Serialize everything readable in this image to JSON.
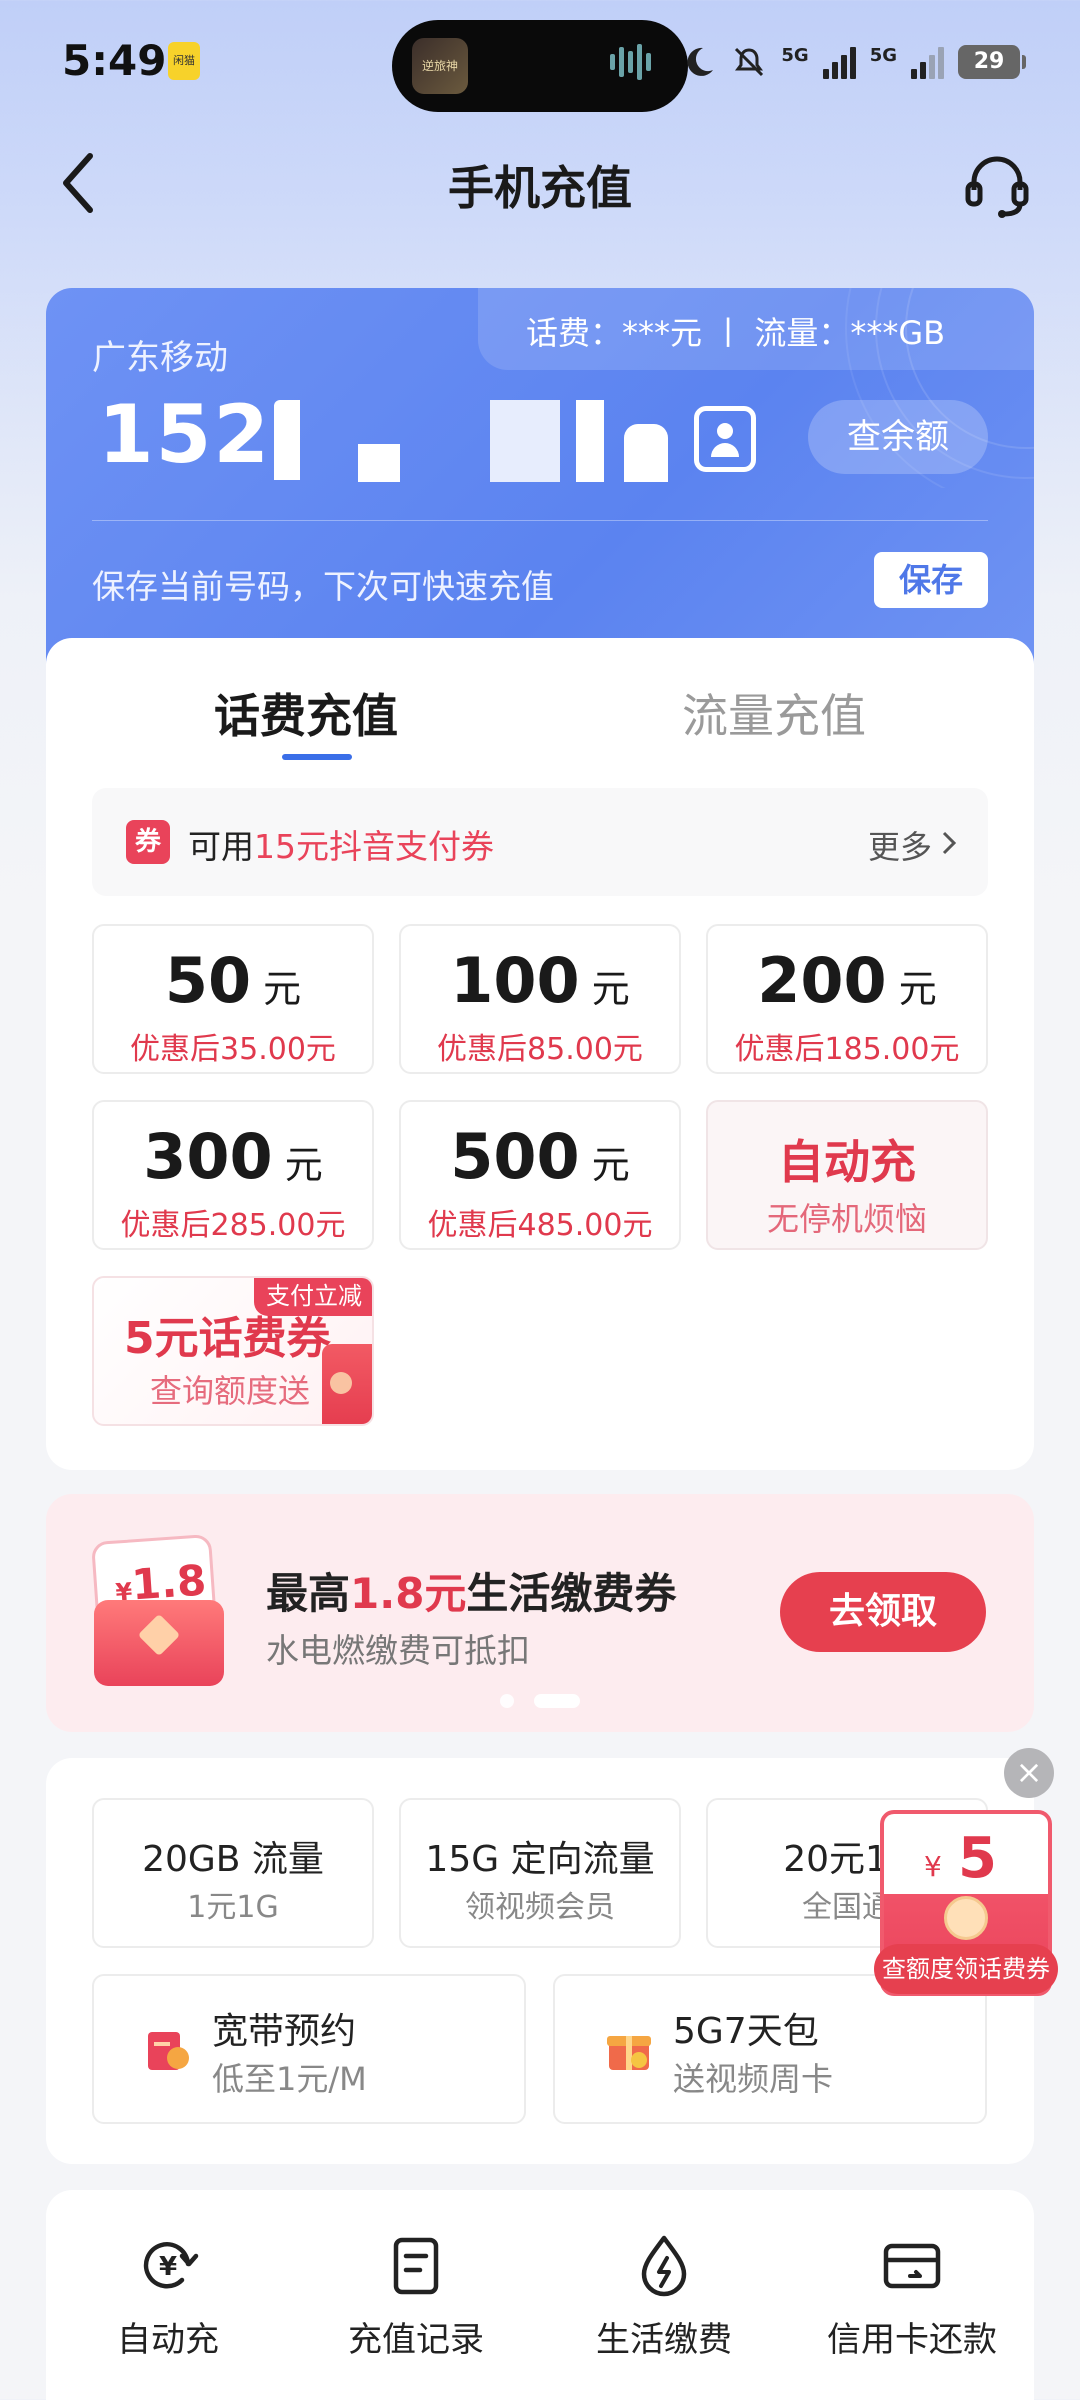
{
  "status_bar": {
    "time": "5:49",
    "app_badge": "闲猫",
    "island_thumb": "逆旅神",
    "network_1": "5G",
    "network_2": "5G",
    "battery": "29"
  },
  "header": {
    "title": "手机充值"
  },
  "phone_card": {
    "balance_info": "话费：***元 丨 流量：***GB",
    "carrier": "广东移动",
    "number_prefix": "152",
    "query_button": "查余额",
    "save_hint": "保存当前号码，下次可快速充值",
    "save_button": "保存"
  },
  "tabs": [
    {
      "label": "话费充值",
      "active": true
    },
    {
      "label": "流量充值",
      "active": false
    }
  ],
  "coupon_bar": {
    "tag": "券",
    "prefix": "可用",
    "highlight": "15元抖音支付券",
    "more": "更多"
  },
  "amounts": [
    {
      "value": "50",
      "unit": "元",
      "discount": "优惠后35.00元"
    },
    {
      "value": "100",
      "unit": "元",
      "discount": "优惠后85.00元"
    },
    {
      "value": "200",
      "unit": "元",
      "discount": "优惠后185.00元"
    },
    {
      "value": "300",
      "unit": "元",
      "discount": "优惠后285.00元"
    },
    {
      "value": "500",
      "unit": "元",
      "discount": "优惠后485.00元"
    }
  ],
  "auto_recharge": {
    "title": "自动充",
    "subtitle": "无停机烦恼"
  },
  "voucher": {
    "badge": "支付立减",
    "title": "5元话费券",
    "subtitle": "查询额度送"
  },
  "banner": {
    "packet_symbol": "¥",
    "packet_amount": "1.8",
    "title_prefix": "最高",
    "title_highlight": "1.8元",
    "title_suffix": "生活缴费券",
    "subtitle": "水电燃缴费可抵扣",
    "button": "去领取"
  },
  "services": [
    {
      "title": "20GB 流量",
      "subtitle": "1元1G"
    },
    {
      "title": "15G 定向流量",
      "subtitle": "领视频会员"
    },
    {
      "title": "20元10",
      "subtitle": "全国通"
    }
  ],
  "services_wide": [
    {
      "title": "宽带预约",
      "subtitle": "低至1元/M"
    },
    {
      "title": "5G7天包",
      "subtitle": "送视频周卡"
    }
  ],
  "floating_packet": {
    "close": "×",
    "symbol": "¥",
    "amount": "5",
    "label": "查额度领话费券"
  },
  "bottom_nav": [
    {
      "label": "自动充",
      "icon": "auto-recharge-icon"
    },
    {
      "label": "充值记录",
      "icon": "records-icon"
    },
    {
      "label": "生活缴费",
      "icon": "utility-icon"
    },
    {
      "label": "信用卡还款",
      "icon": "credit-card-icon"
    }
  ],
  "colors": {
    "accent_blue": "#5b83f0",
    "accent_red": "#e0394d"
  }
}
